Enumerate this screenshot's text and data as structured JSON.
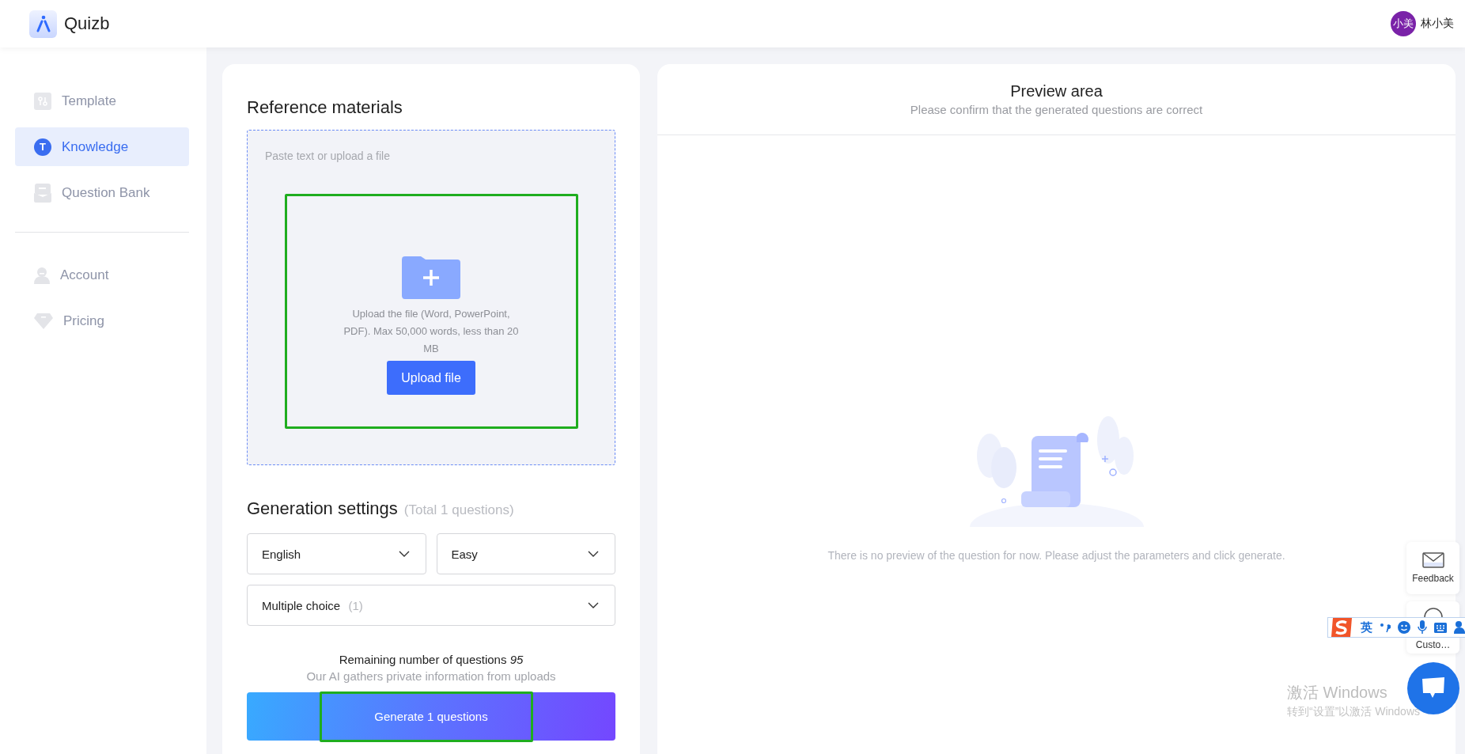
{
  "header": {
    "logo_text": "Quizb",
    "user": {
      "avatar_text": "小美",
      "name": "林小美"
    }
  },
  "sidebar": {
    "items": [
      {
        "label": "Template",
        "selected": false,
        "kind": "template"
      },
      {
        "label": "Knowledge",
        "selected": true,
        "kind": "letter",
        "icon_text": "T"
      },
      {
        "label": "Question Bank",
        "selected": false,
        "kind": "bank"
      }
    ],
    "secondary_items": [
      {
        "label": "Account",
        "selected": false,
        "kind": "person"
      },
      {
        "label": "Pricing",
        "selected": false,
        "kind": "gem"
      }
    ]
  },
  "reference": {
    "title": "Reference materials",
    "placeholder": "Paste text or upload a file",
    "upload_hint": "Upload the file (Word, PowerPoint, PDF). Max 50,000 words, less than 20 MB",
    "upload_button": "Upload file"
  },
  "settings": {
    "title": "Generation settings",
    "total": "(Total 1 questions)",
    "selects": [
      {
        "value": "English"
      },
      {
        "value": "Easy"
      }
    ],
    "type_select": {
      "value": "Multiple choice",
      "count": "(1)"
    },
    "remaining": "Remaining number of questions *95*",
    "note": "Our AI gathers private information from uploads",
    "generate_button": "Generate 1 questions"
  },
  "preview": {
    "title": "Preview area",
    "subtitle": "Please confirm that the generated questions are correct",
    "empty_text": "There is no preview of the question for now. Please adjust the parameters and click generate."
  },
  "floating": [
    {
      "kind": "feedback",
      "label": "Feedback"
    },
    {
      "kind": "customer",
      "label": "Custo…"
    }
  ],
  "ime_bar": {
    "text": "英"
  },
  "activation": {
    "title": "激活 Windows",
    "subtitle": "转到“设置”以激活 Windows"
  }
}
